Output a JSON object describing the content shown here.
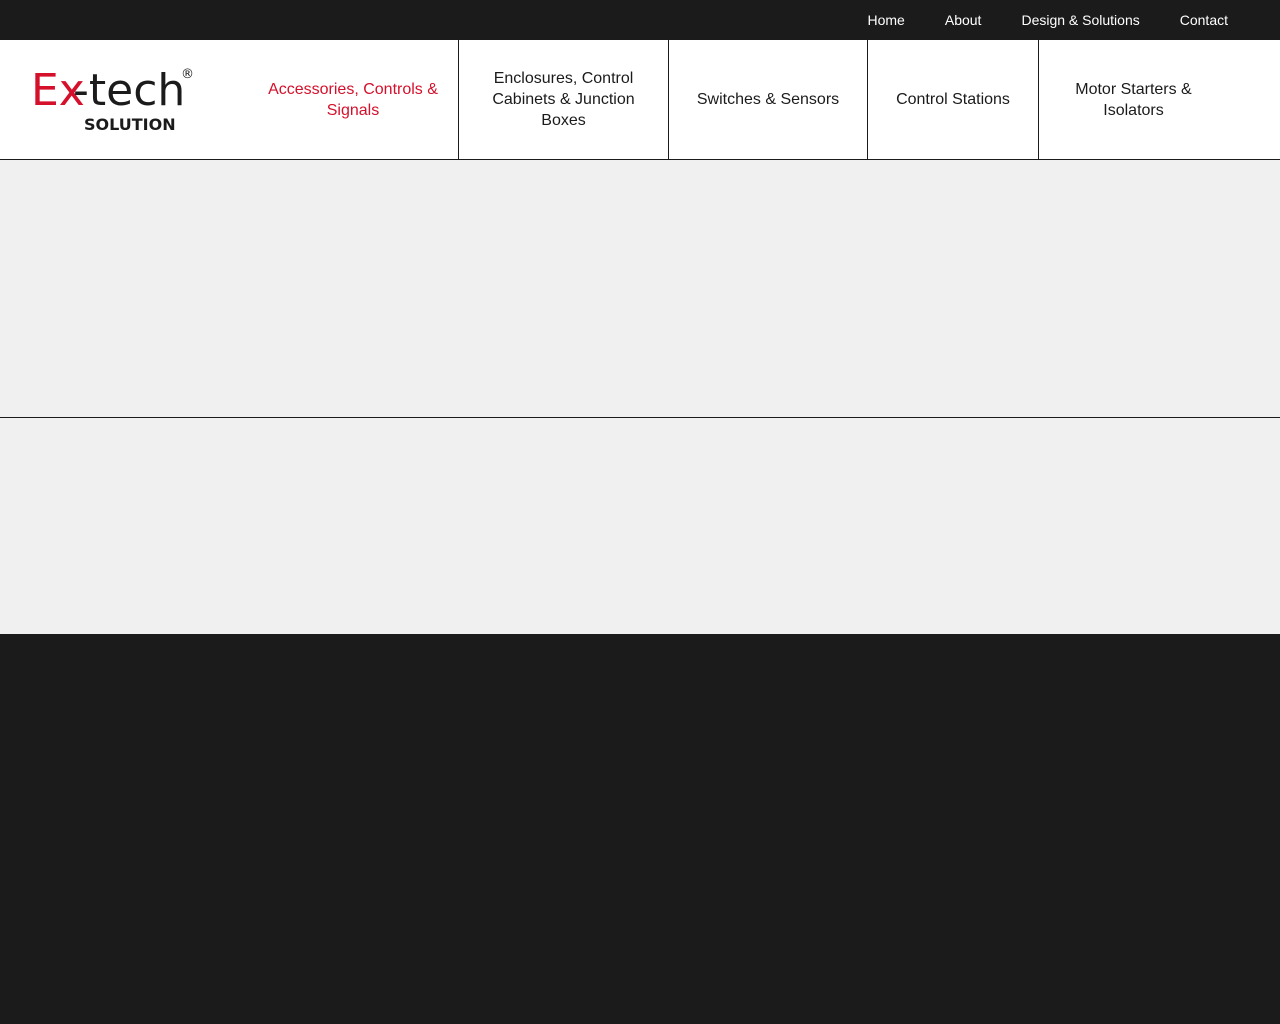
{
  "colors": {
    "dark": "#1b1b1b",
    "accent": "#d5102b",
    "light_bg": "#f0f0f0",
    "white": "#ffffff"
  },
  "top_nav": {
    "items": [
      "Home",
      "About",
      "Design & Solutions",
      "Contact"
    ]
  },
  "logo": {
    "wordmark_ex": "Ex",
    "wordmark_tech": "-tech",
    "registered": "®",
    "subline": "SOLUTION"
  },
  "categories": [
    {
      "label": "Accessories, Controls & Signals",
      "active": true
    },
    {
      "label": "Enclosures, Control Cabinets & Junction Boxes",
      "active": false
    },
    {
      "label": "Switches & Sensors",
      "active": false
    },
    {
      "label": "Control Stations",
      "active": false
    },
    {
      "label": "Motor Starters & Isolators",
      "active": false
    }
  ]
}
